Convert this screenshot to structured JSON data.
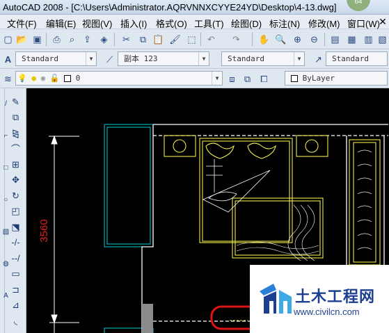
{
  "window": {
    "title": "AutoCAD 2008 - [C:\\Users\\Administrator.AQRVNNXCYYE24YD\\Desktop\\4-13.dwg]",
    "badge": "64"
  },
  "menu": {
    "items": [
      "文件(F)",
      "编辑(E)",
      "视图(V)",
      "插入(I)",
      "格式(O)",
      "工具(T)",
      "绘图(D)",
      "标注(N)",
      "修改(M)",
      "窗口(W)"
    ]
  },
  "styles_toolbar": {
    "text_style": "Standard",
    "dim_style": "副本 123",
    "table_style": "Standard",
    "multileader_style": "Standard"
  },
  "layers_toolbar": {
    "current_layer": "0",
    "linetype": "ByLayer"
  },
  "drawing": {
    "dimension_value": "3560"
  },
  "watermark": {
    "name": "土木工程网",
    "url": "www.civilcn.com"
  },
  "colors": {
    "canvas": "#000000",
    "walls": "#ffffff",
    "window": "#00d2d2",
    "furniture": "#f0e84a",
    "dimension_text": "#e02020",
    "highlight": "#e01414",
    "watermark": "#1c3f8f"
  }
}
